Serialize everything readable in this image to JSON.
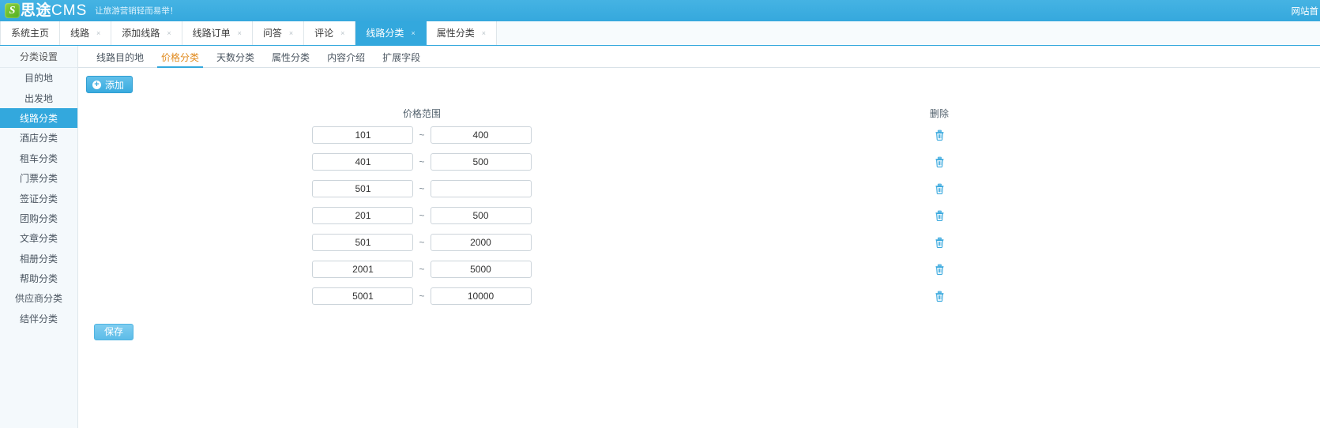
{
  "brand": {
    "logo_mark": "S",
    "name_cn": "思途",
    "name_en": "CMS",
    "slogan": "让旅游营销轻而易举！",
    "right_link": "网站首"
  },
  "main_tabs": [
    {
      "label": "系统主页",
      "closable": false,
      "active": false
    },
    {
      "label": "线路",
      "closable": true,
      "active": false
    },
    {
      "label": "添加线路",
      "closable": true,
      "active": false
    },
    {
      "label": "线路订单",
      "closable": true,
      "active": false
    },
    {
      "label": "问答",
      "closable": true,
      "active": false
    },
    {
      "label": "评论",
      "closable": true,
      "active": false
    },
    {
      "label": "线路分类",
      "closable": true,
      "active": true
    },
    {
      "label": "属性分类",
      "closable": true,
      "active": false
    }
  ],
  "tab_close_glyph": "×",
  "sidebar": {
    "title": "分类设置",
    "items": [
      {
        "label": "目的地",
        "active": false
      },
      {
        "label": "出发地",
        "active": false
      },
      {
        "label": "线路分类",
        "active": true
      },
      {
        "label": "酒店分类",
        "active": false
      },
      {
        "label": "租车分类",
        "active": false
      },
      {
        "label": "门票分类",
        "active": false
      },
      {
        "label": "签证分类",
        "active": false
      },
      {
        "label": "团购分类",
        "active": false
      },
      {
        "label": "文章分类",
        "active": false
      },
      {
        "label": "相册分类",
        "active": false
      },
      {
        "label": "帮助分类",
        "active": false
      },
      {
        "label": "供应商分类",
        "active": false
      },
      {
        "label": "结伴分类",
        "active": false
      }
    ]
  },
  "sub_tabs": [
    {
      "label": "线路目的地",
      "active": false
    },
    {
      "label": "价格分类",
      "active": true
    },
    {
      "label": "天数分类",
      "active": false
    },
    {
      "label": "属性分类",
      "active": false
    },
    {
      "label": "内容介绍",
      "active": false
    },
    {
      "label": "扩展字段",
      "active": false
    }
  ],
  "toolbar": {
    "add_label": "添加",
    "add_icon": "plus-circle-icon"
  },
  "table": {
    "header_range": "价格范围",
    "header_delete": "删除",
    "separator": "~",
    "min_placeholder": "",
    "max_placeholder": "",
    "delete_icon": "trash-icon",
    "rows": [
      {
        "min": "101",
        "max": "400"
      },
      {
        "min": "401",
        "max": "500"
      },
      {
        "min": "501",
        "max": ""
      },
      {
        "min": "201",
        "max": "500"
      },
      {
        "min": "501",
        "max": "2000"
      },
      {
        "min": "2001",
        "max": "5000"
      },
      {
        "min": "5001",
        "max": "10000"
      }
    ]
  },
  "footer": {
    "save_label": "保存"
  },
  "colors": {
    "brand_blue": "#33a8dd",
    "accent_orange": "#e08a1e",
    "logo_green": "#66bb2e",
    "sidebar_bg": "#f4f9fc"
  }
}
